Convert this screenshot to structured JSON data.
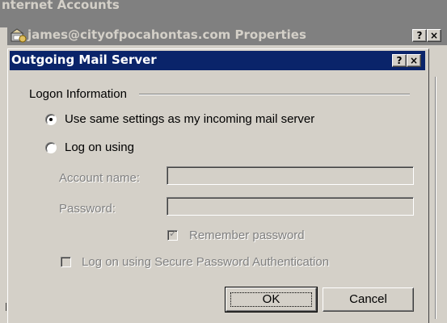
{
  "background_window": {
    "title": "nternet Accounts"
  },
  "properties_window": {
    "title": "james@cityofpocahontas.com Properties",
    "help_button": "?",
    "close_button": "×"
  },
  "dialog": {
    "title": "Outgoing Mail Server",
    "help_button": "?",
    "close_button": "×",
    "title_color": "#0a246a",
    "group_label": "Logon Information",
    "options": {
      "same_settings": {
        "label": "Use same settings as my incoming mail server",
        "selected": true
      },
      "log_on_using": {
        "label": "Log on using",
        "selected": false
      }
    },
    "account_name": {
      "label": "Account name:",
      "value": ""
    },
    "password": {
      "label": "Password:",
      "value": ""
    },
    "remember_password": {
      "label": "Remember password",
      "checked": true,
      "enabled": false
    },
    "spa": {
      "label": "Log on using Secure Password Authentication",
      "checked": false,
      "enabled": false
    },
    "ok_label": "OK",
    "cancel_label": "Cancel"
  }
}
